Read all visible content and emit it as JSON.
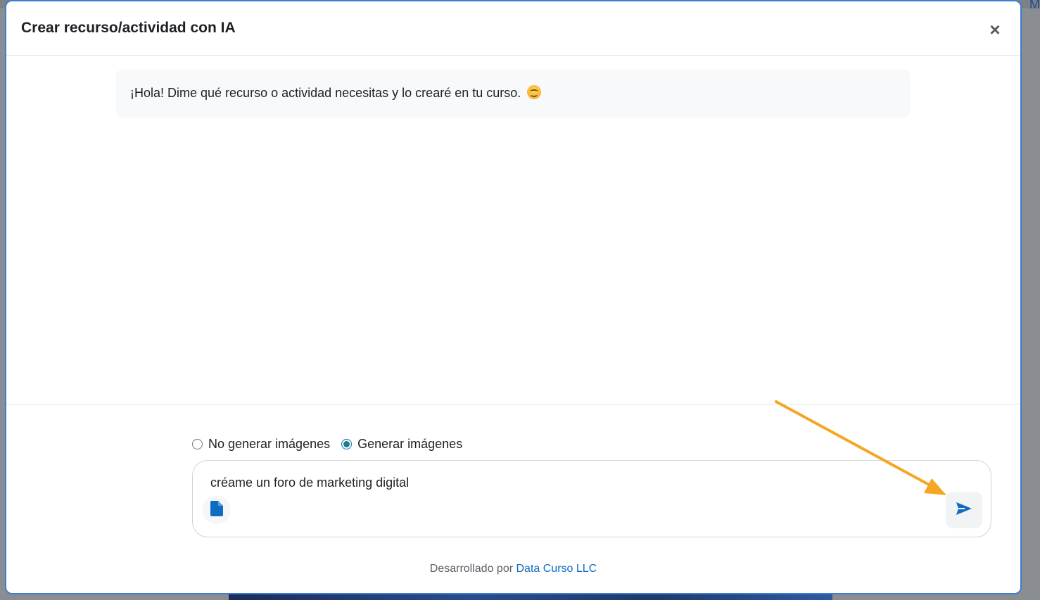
{
  "backdrop": {
    "right_link_text": "M"
  },
  "modal": {
    "title": "Crear recurso/actividad con IA",
    "close_label": "×"
  },
  "chat": {
    "messages": [
      {
        "role": "assistant",
        "text": "¡Hola! Dime qué recurso o actividad necesitas y lo crearé en tu curso."
      }
    ]
  },
  "image_options": {
    "options": [
      {
        "label": "No generar imágenes",
        "checked": false
      },
      {
        "label": "Generar imágenes",
        "checked": true
      }
    ]
  },
  "composer": {
    "value": "créame un foro de marketing digital",
    "attach_icon": "file-icon",
    "send_icon": "send-icon"
  },
  "footer": {
    "prefix": "Desarrollado por",
    "link_text": "Data Curso LLC"
  },
  "colors": {
    "accent": "#0f6cbf",
    "arrow": "#f5a623",
    "radio_checked": "#1a7f8a"
  }
}
